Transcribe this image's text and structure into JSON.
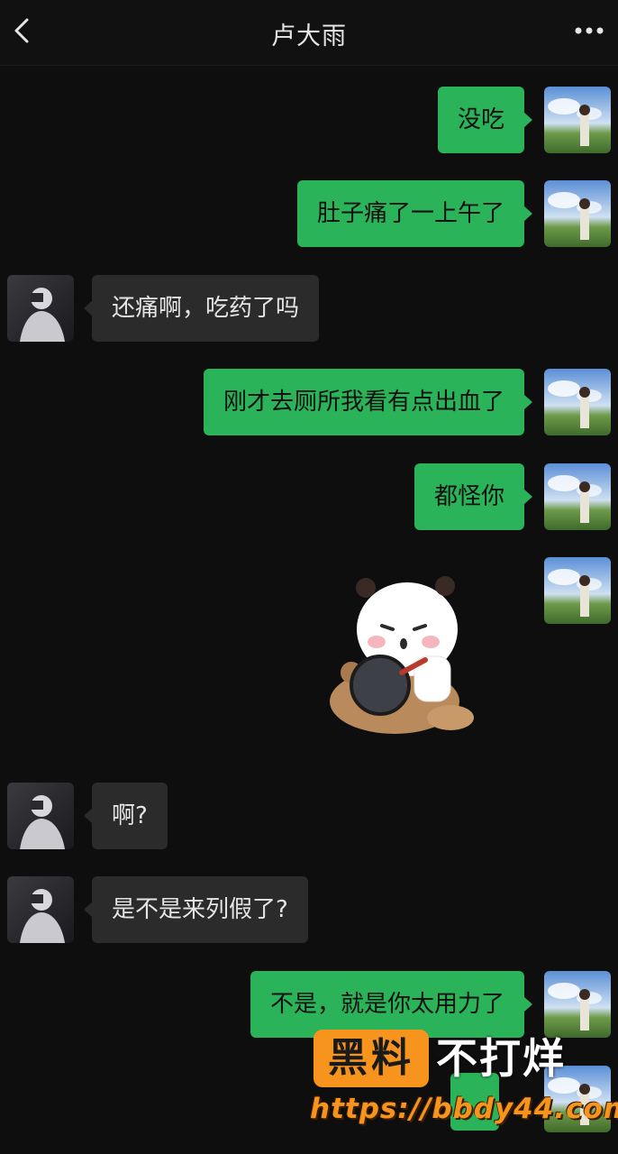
{
  "header": {
    "title": "卢大雨",
    "back_icon": "chevron-left-icon",
    "more_icon": "more-dots-icon"
  },
  "messages": [
    {
      "side": "self",
      "text": "没吃"
    },
    {
      "side": "self",
      "text": "肚子痛了一上午了"
    },
    {
      "side": "other",
      "text": "还痛啊，吃药了吗"
    },
    {
      "side": "self",
      "text": "刚才去厕所我看有点出血了"
    },
    {
      "side": "self",
      "text": "都怪你"
    },
    {
      "side": "self",
      "type": "sticker",
      "sticker": "panda-hitting-bear-with-pan"
    },
    {
      "side": "other",
      "text": "啊?"
    },
    {
      "side": "other",
      "text": "是不是来列假了?"
    },
    {
      "side": "self",
      "text": "不是，就是你太用力了"
    }
  ],
  "watermark": {
    "badge": "黑料",
    "text": "不打烊",
    "url": "https://bbdy44.com"
  },
  "colors": {
    "background": "#0e0e0e",
    "self_bubble": "#2bb35a",
    "other_bubble": "#2b2b2b",
    "watermark_orange": "#f7941d"
  }
}
